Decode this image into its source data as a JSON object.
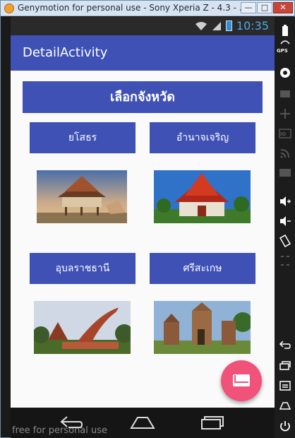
{
  "window": {
    "title": "Genymotion for personal use - Sony Xperia Z - 4.3 - ...",
    "minimize_label": "—",
    "maximize_label": "□",
    "close_label": "✕"
  },
  "status_bar": {
    "time": "10:35"
  },
  "app_bar": {
    "title": "DetailActivity"
  },
  "content": {
    "header_button": "เลือกจังหวัด",
    "provinces": [
      {
        "label": "ยโสธร",
        "photo": "temple-stilt-house-photo"
      },
      {
        "label": "อำนาจเจริญ",
        "photo": "red-temple-photo"
      },
      {
        "label": "อุบลราชธานี",
        "photo": "naga-temple-photo"
      },
      {
        "label": "ศรีสะเกษ",
        "photo": "khmer-ruins-photo"
      }
    ]
  },
  "fab": {
    "icon": "email-icon",
    "color": "#f0527a"
  },
  "nav_bar": {
    "watermark": "free for personal use"
  },
  "sidebar": {
    "gps_label": "GPS",
    "id_label": "ID"
  },
  "colors": {
    "primary": "#3f51b5",
    "accent": "#f0527a",
    "status_bar": "#2a2a2a"
  }
}
